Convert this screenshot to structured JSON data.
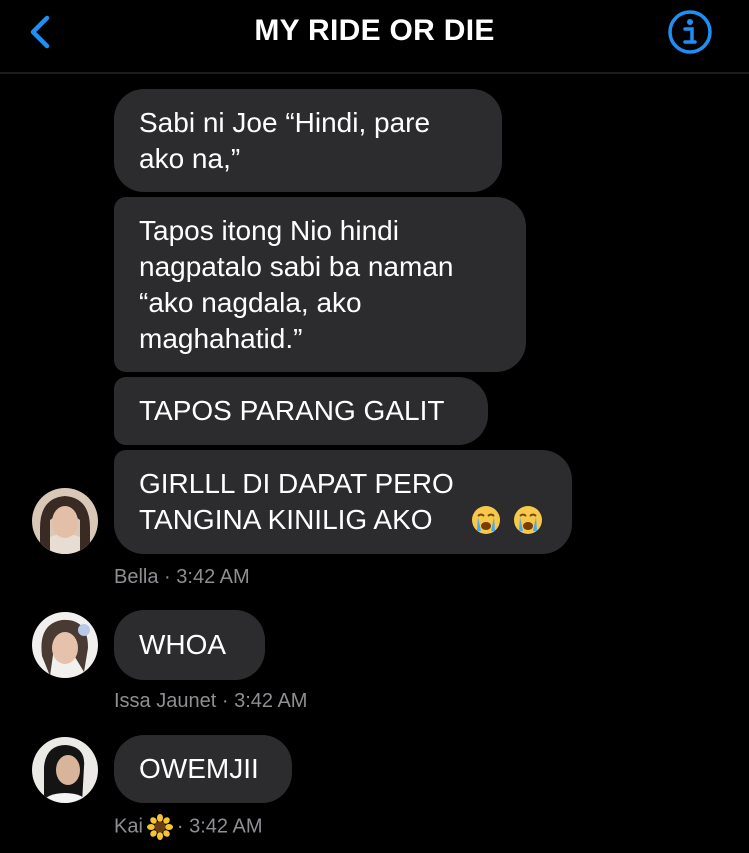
{
  "header": {
    "title": "MY RIDE OR DIE",
    "back_icon": "chevron-left-icon",
    "info_icon": "info-icon",
    "accent": "#1f8ff5"
  },
  "messages": [
    {
      "text": "Sabi ni Joe “Hindi, pare\nako na,”"
    },
    {
      "text": "Tapos itong Nio hindi\nnagpatalo sabi ba naman\n“ako nagdala, ako\nmaghahatid.”"
    },
    {
      "text": "TAPOS PARANG GALIT"
    },
    {
      "text": "GIRLLL DI DAPAT PERO\nTANGINA KINILIG AKO",
      "emojis": [
        "crying-face-icon",
        "crying-face-icon"
      ]
    },
    {
      "text": "WHOA"
    },
    {
      "text": "OWEMJII"
    }
  ],
  "groups": [
    {
      "sender": "Bella",
      "time": "· 3:42 AM"
    },
    {
      "sender": "Issa Jaunet",
      "time": "· 3:42 AM"
    },
    {
      "sender": "Kai",
      "sender_icon": "sunflower-icon",
      "time": "· 3:42 AM"
    }
  ],
  "colors": {
    "bubble": "#2c2c2e",
    "meta_text": "#8e8e93",
    "background": "#000000"
  }
}
